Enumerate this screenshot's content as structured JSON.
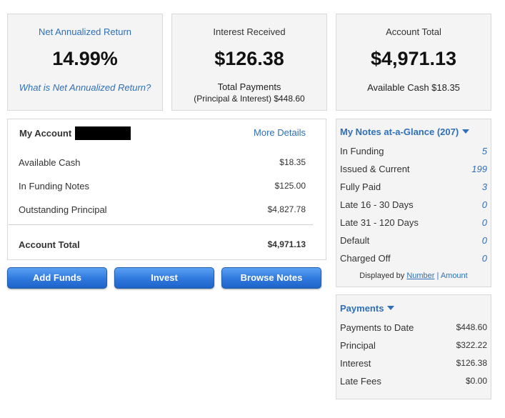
{
  "stats": {
    "net_annualized": {
      "label": "Net Annualized Return",
      "value": "14.99%",
      "help_link": "What is Net Annualized Return?"
    },
    "interest": {
      "label": "Interest Received",
      "value": "$126.38",
      "sub_line1": "Total Payments",
      "sub_line2": "(Principal & Interest) $448.60"
    },
    "account_total": {
      "label": "Account Total",
      "value": "$4,971.13",
      "sub": "Available Cash $18.35"
    }
  },
  "my_account": {
    "title": "My Account",
    "more_details": "More Details",
    "rows": [
      {
        "label": "Available Cash",
        "value": "$18.35"
      },
      {
        "label": "In Funding Notes",
        "value": "$125.00"
      },
      {
        "label": "Outstanding Principal",
        "value": "$4,827.78"
      }
    ],
    "total_label": "Account Total",
    "total_value": "$4,971.13"
  },
  "buttons": {
    "add_funds": "Add Funds",
    "invest": "Invest",
    "browse_notes": "Browse Notes"
  },
  "notes_glance": {
    "title": "My Notes at-a-Glance (207)",
    "rows": [
      {
        "label": "In Funding",
        "value": "5"
      },
      {
        "label": "Issued & Current",
        "value": "199"
      },
      {
        "label": "Fully Paid",
        "value": "3"
      },
      {
        "label": "Late 16 - 30 Days",
        "value": "0"
      },
      {
        "label": "Late 31 - 120 Days",
        "value": "0"
      },
      {
        "label": "Default",
        "value": "0"
      },
      {
        "label": "Charged Off",
        "value": "0"
      }
    ],
    "displayed_by": "Displayed by",
    "number_link": "Number",
    "separator": "|",
    "amount_link": "Amount"
  },
  "payments": {
    "title": "Payments",
    "rows": [
      {
        "label": "Payments to Date",
        "value": "$448.60"
      },
      {
        "label": "Principal",
        "value": "$322.22"
      },
      {
        "label": "Interest",
        "value": "$126.38"
      },
      {
        "label": "Late Fees",
        "value": "$0.00"
      }
    ]
  },
  "colors": {
    "accent": "#2f6fb8",
    "panel_bg": "#f4f4f4",
    "button": "#2f78dd"
  }
}
